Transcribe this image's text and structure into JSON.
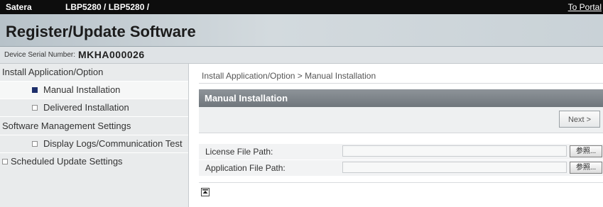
{
  "topbar": {
    "brand": "Satera",
    "model": "LBP5280 / LBP5280 /",
    "portal_link": "To Portal"
  },
  "title": "Register/Update Software",
  "device": {
    "serial_label": "Device Serial Number:",
    "serial_value": "MKHA000026"
  },
  "sidebar": {
    "items": [
      {
        "label": "Install Application/Option",
        "type": "group"
      },
      {
        "label": "Manual Installation",
        "type": "sub",
        "active": true
      },
      {
        "label": "Delivered Installation",
        "type": "sub"
      },
      {
        "label": "Software Management Settings",
        "type": "group"
      },
      {
        "label": "Display Logs/Communication Test",
        "type": "sub"
      },
      {
        "label": "Scheduled Update Settings",
        "type": "item"
      }
    ]
  },
  "main": {
    "breadcrumb": "Install Application/Option > Manual Installation",
    "panel_title": "Manual Installation",
    "next_button": "Next >",
    "fields": [
      {
        "label": "License File Path:",
        "value": "",
        "browse_label": "参照..."
      },
      {
        "label": "Application File Path:",
        "value": "",
        "browse_label": "参照..."
      }
    ]
  },
  "icons": {
    "bullet_active": "filled-square-bullet",
    "bullet_inactive": "hollow-square-bullet",
    "back_to_top": "arrow-up-to-top-icon"
  }
}
